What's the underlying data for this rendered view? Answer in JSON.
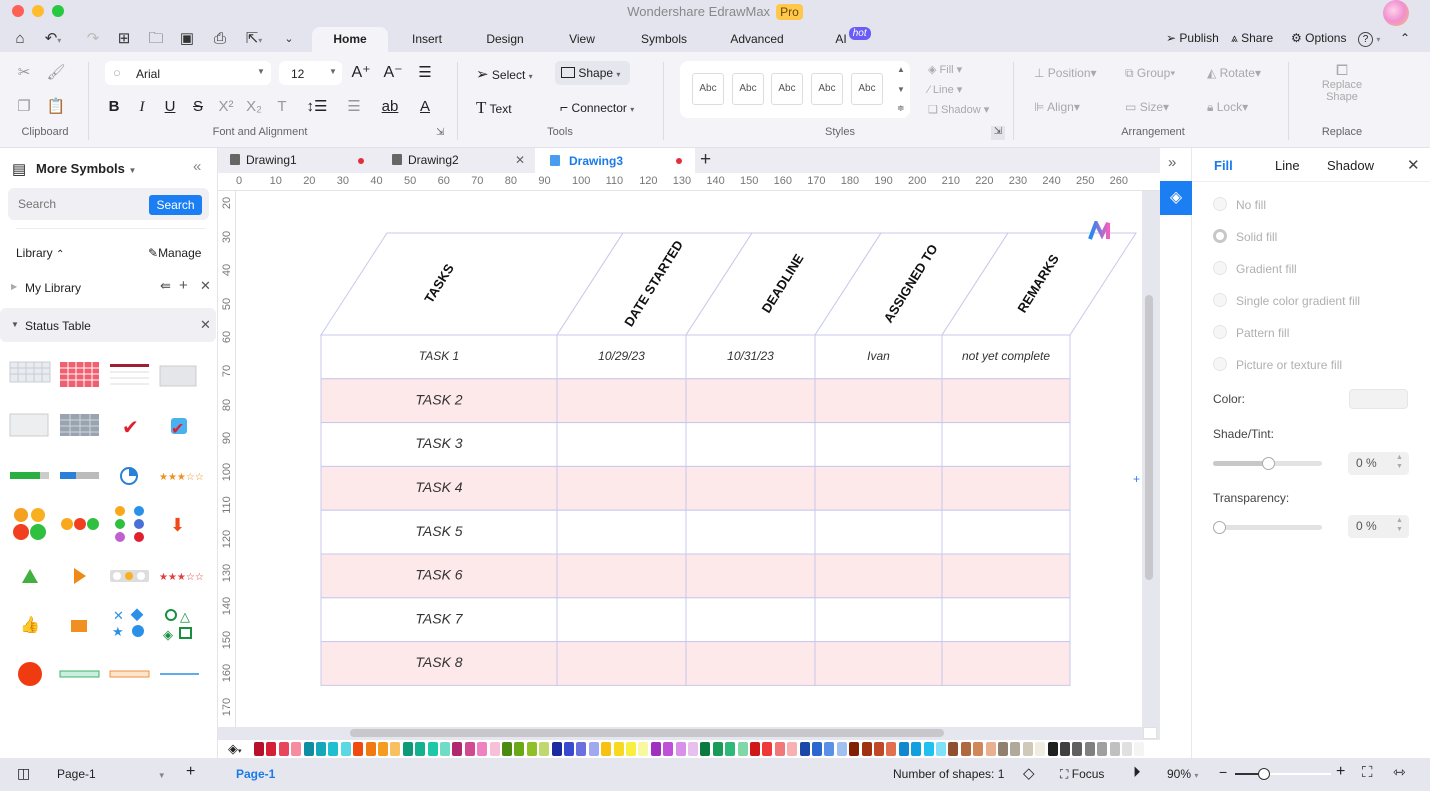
{
  "app": {
    "title": "Wondershare EdrawMax",
    "badge": "Pro"
  },
  "menu_tabs": [
    {
      "label": "Home",
      "active": true
    },
    {
      "label": "Insert"
    },
    {
      "label": "Design"
    },
    {
      "label": "View"
    },
    {
      "label": "Symbols"
    },
    {
      "label": "Advanced"
    },
    {
      "label": "AI",
      "badge": "hot"
    }
  ],
  "top_right": {
    "publish": "Publish",
    "share": "Share",
    "options": "Options"
  },
  "ribbon": {
    "clipboard_label": "Clipboard",
    "font_family": "Arial",
    "font_size": "12",
    "font_group_label": "Font and Alignment",
    "tools": {
      "select": "Select",
      "shape": "Shape",
      "text": "Text",
      "connector": "Connector",
      "group_label": "Tools"
    },
    "styles": {
      "items": [
        "Abc",
        "Abc",
        "Abc",
        "Abc",
        "Abc"
      ],
      "fill": "Fill",
      "line": "Line",
      "shadow": "Shadow",
      "group_label": "Styles"
    },
    "arrangement": {
      "position": "Position",
      "group": "Group",
      "rotate": "Rotate",
      "align": "Align",
      "size": "Size",
      "lock": "Lock",
      "group_label": "Arrangement"
    },
    "replace": {
      "line1": "Replace",
      "line2": "Shape",
      "group_label": "Replace"
    }
  },
  "left_panel": {
    "title": "More Symbols",
    "search_placeholder": "Search",
    "search_button": "Search",
    "library_label": "Library",
    "manage_label": "Manage",
    "my_library": "My Library",
    "status_table": "Status Table"
  },
  "doc_tabs": [
    {
      "label": "Drawing1",
      "unsaved": true
    },
    {
      "label": "Drawing2",
      "unsaved": false
    },
    {
      "label": "Drawing3",
      "unsaved": true,
      "active": true
    }
  ],
  "ruler": {
    "h": [
      "0",
      "10",
      "20",
      "30",
      "40",
      "50",
      "60",
      "70",
      "80",
      "90",
      "100",
      "110",
      "120",
      "130",
      "140",
      "150",
      "160",
      "170",
      "180",
      "190",
      "200",
      "210",
      "220",
      "230",
      "240",
      "250",
      "260"
    ],
    "v": [
      "20",
      "30",
      "40",
      "50",
      "60",
      "70",
      "80",
      "90",
      "100",
      "110",
      "120",
      "130",
      "140",
      "150",
      "160",
      "170"
    ]
  },
  "table": {
    "headers": [
      "TASKS",
      "DATE STARTED",
      "DEADLINE",
      "ASSIGNED TO",
      "REMARKS"
    ],
    "rows": [
      [
        "TASK 1",
        "10/29/23",
        "10/31/23",
        "Ivan",
        "not yet complete"
      ],
      [
        "TASK 2",
        "",
        "",
        "",
        ""
      ],
      [
        "TASK 3",
        "",
        "",
        "",
        ""
      ],
      [
        "TASK 4",
        "",
        "",
        "",
        ""
      ],
      [
        "TASK 5",
        "",
        "",
        "",
        ""
      ],
      [
        "TASK 6",
        "",
        "",
        "",
        ""
      ],
      [
        "TASK 7",
        "",
        "",
        "",
        ""
      ],
      [
        "TASK 8",
        "",
        "",
        "",
        ""
      ]
    ],
    "stripe_color": "#fde8ea",
    "border_color": "#c8c8ec"
  },
  "right_panel": {
    "tabs": [
      "Fill",
      "Line",
      "Shadow"
    ],
    "fill_options": [
      "No fill",
      "Solid fill",
      "Gradient fill",
      "Single color gradient fill",
      "Pattern fill",
      "Picture or texture fill"
    ],
    "selected_option": "Solid fill",
    "color_label": "Color:",
    "shade_label": "Shade/Tint:",
    "shade_value": "0 %",
    "transparency_label": "Transparency:",
    "transparency_value": "0 %"
  },
  "palette": [
    "#b8102a",
    "#d41f35",
    "#e8455c",
    "#f58ca0",
    "#0e8ea0",
    "#14a8b8",
    "#1cc0d0",
    "#5ad8e4",
    "#f04a10",
    "#f07a10",
    "#f59c20",
    "#f8c060",
    "#0e9a78",
    "#14b090",
    "#1cc8a8",
    "#70dcc8",
    "#b02870",
    "#d04a90",
    "#f080c0",
    "#f8c0d8",
    "#4a8a10",
    "#6aa818",
    "#90c028",
    "#c0d870",
    "#1a2aa0",
    "#3a4ad0",
    "#6a70e0",
    "#a0a8f0",
    "#f8c010",
    "#f8d820",
    "#f8f040",
    "#f8f8a0",
    "#a030c0",
    "#c050d8",
    "#d890e8",
    "#e8c0f0",
    "#0a7a40",
    "#1a9a58",
    "#30b878",
    "#80d8a8",
    "#d01818",
    "#f03838",
    "#f07878",
    "#f8b0b0",
    "#1a48a8",
    "#2a68d0",
    "#5a90e8",
    "#a0c0f0",
    "#802000",
    "#a03010",
    "#c04828",
    "#e07050",
    "#1088d0",
    "#10a0e0",
    "#20c0f0",
    "#80e0f8",
    "#905030",
    "#b06840",
    "#d08858",
    "#e8b090",
    "#908070",
    "#b0a898",
    "#d0c8b8",
    "#f0ece0",
    "#202020",
    "#404040",
    "#606060",
    "#808080",
    "#a0a0a0",
    "#c0c0c0",
    "#e0e0e0",
    "#f4f4f4"
  ],
  "status": {
    "page_selector": "Page-1",
    "page_tab": "Page-1",
    "shapes": "Number of shapes: 1",
    "focus": "Focus",
    "zoom": "90%",
    "zoom_fraction": 0.3
  }
}
